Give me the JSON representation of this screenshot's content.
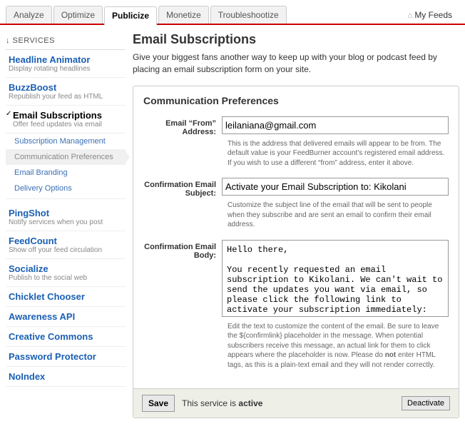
{
  "tabs": {
    "items": [
      "Analyze",
      "Optimize",
      "Publicize",
      "Monetize",
      "Troubleshootize"
    ],
    "active_index": 2,
    "my_feeds": "My Feeds"
  },
  "sidebar": {
    "header": "↓ SERVICES",
    "groups": [
      {
        "title": "Headline Animator",
        "desc": "Display rotating headlines"
      },
      {
        "title": "BuzzBoost",
        "desc": "Republish your feed as HTML"
      },
      {
        "title": "Email Subscriptions",
        "desc": "Offer feed updates via email",
        "active": true,
        "subs": [
          {
            "label": "Subscription Management"
          },
          {
            "label": "Communication Preferences",
            "active": true
          },
          {
            "label": "Email Branding"
          },
          {
            "label": "Delivery Options"
          }
        ]
      },
      {
        "title": "PingShot",
        "desc": "Notify services when you post"
      },
      {
        "title": "FeedCount",
        "desc": "Show off your feed circulation"
      },
      {
        "title": "Socialize",
        "desc": "Publish to the social web"
      },
      {
        "title": "Chicklet Chooser"
      },
      {
        "title": "Awareness API"
      },
      {
        "title": "Creative Commons"
      },
      {
        "title": "Password Protector"
      },
      {
        "title": "NoIndex"
      }
    ]
  },
  "main": {
    "title": "Email Subscriptions",
    "desc": "Give your biggest fans another way to keep up with your blog or podcast feed by placing an email subscription form on your site.",
    "panel_title": "Communication Preferences",
    "from_label": "Email “From” Address:",
    "from_value": "leilaniana@gmail.com",
    "from_help": "This is the address that delivered emails will appear to be from. The default value is your FeedBurner account's registered email address. If you wish to use a different “from” address, enter it above.",
    "subject_label": "Confirmation Email Subject:",
    "subject_value": "Activate your Email Subscription to: Kikolani",
    "subject_help": "Customize the subject line of the email that will be sent to people when they subscribe and are sent an email to confirm their email address.",
    "body_label": "Confirmation Email Body:",
    "body_value": "Hello there,\n\nYou recently requested an email subscription to Kikolani. We can't wait to send the updates you want via email, so please click the following link to activate your subscription immediately:",
    "body_help_pre": "Edit the text to customize the content of the email. Be sure to leave the ${confirmlink} placeholder in the message. When potential subscribers receive this message, an actual link for them to click appears where the placeholder is now. Please do ",
    "body_help_bold": "not",
    "body_help_post": " enter HTML tags, as this is a plain-text email and they will not render correctly.",
    "save_label": "Save",
    "status_pre": "This service is ",
    "status_bold": "active",
    "deactivate_label": "Deactivate"
  }
}
